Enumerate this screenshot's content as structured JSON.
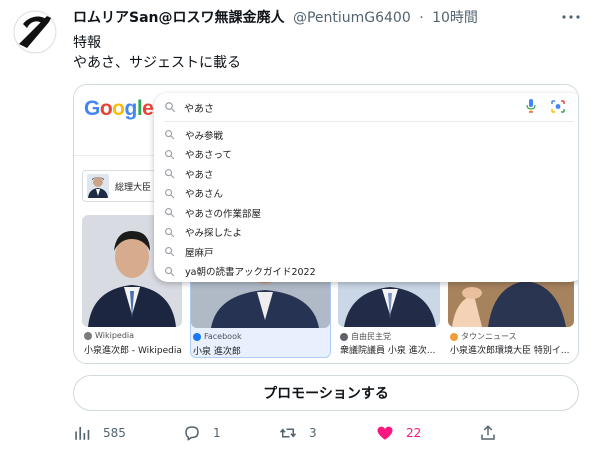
{
  "tweet": {
    "author_name": "ロムリアSan@ロスワ無課金廃人",
    "handle": "@PentiumG6400",
    "separator": "·",
    "time": "10時間",
    "text_line1": "特報",
    "text_line2": "やあさ、サジェストに載る"
  },
  "card": {
    "search_query": "やあさ",
    "suggestions": [
      "やみ参戦",
      "やあさって",
      "やあさ",
      "やあさん",
      "やあさの作業部屋",
      "やみ探したよ",
      "屋麻戸",
      "ya朝の読書アックガイド2022"
    ],
    "knowledge_chip": "総理大臣",
    "results": [
      {
        "source": "Wikipedia",
        "title": "小泉進次郎 - Wikipedia"
      },
      {
        "source": "Facebook",
        "title": "小泉 進次郎"
      },
      {
        "source": "自由民主党",
        "title": "衆議院議員 小泉 進次..."
      },
      {
        "source": "タウンニュース",
        "title": "小泉進次郎環境大臣 特別イ..."
      }
    ],
    "colors": {
      "google_blue": "#4285f4",
      "google_red": "#ea4335",
      "google_yellow": "#fbbc05",
      "google_green": "#34a853"
    }
  },
  "promote_label": "プロモーションする",
  "metrics": {
    "views": "585",
    "replies": "1",
    "retweets": "3",
    "likes": "22"
  },
  "colors": {
    "like_pink": "#f91880",
    "text_secondary": "#536471"
  }
}
